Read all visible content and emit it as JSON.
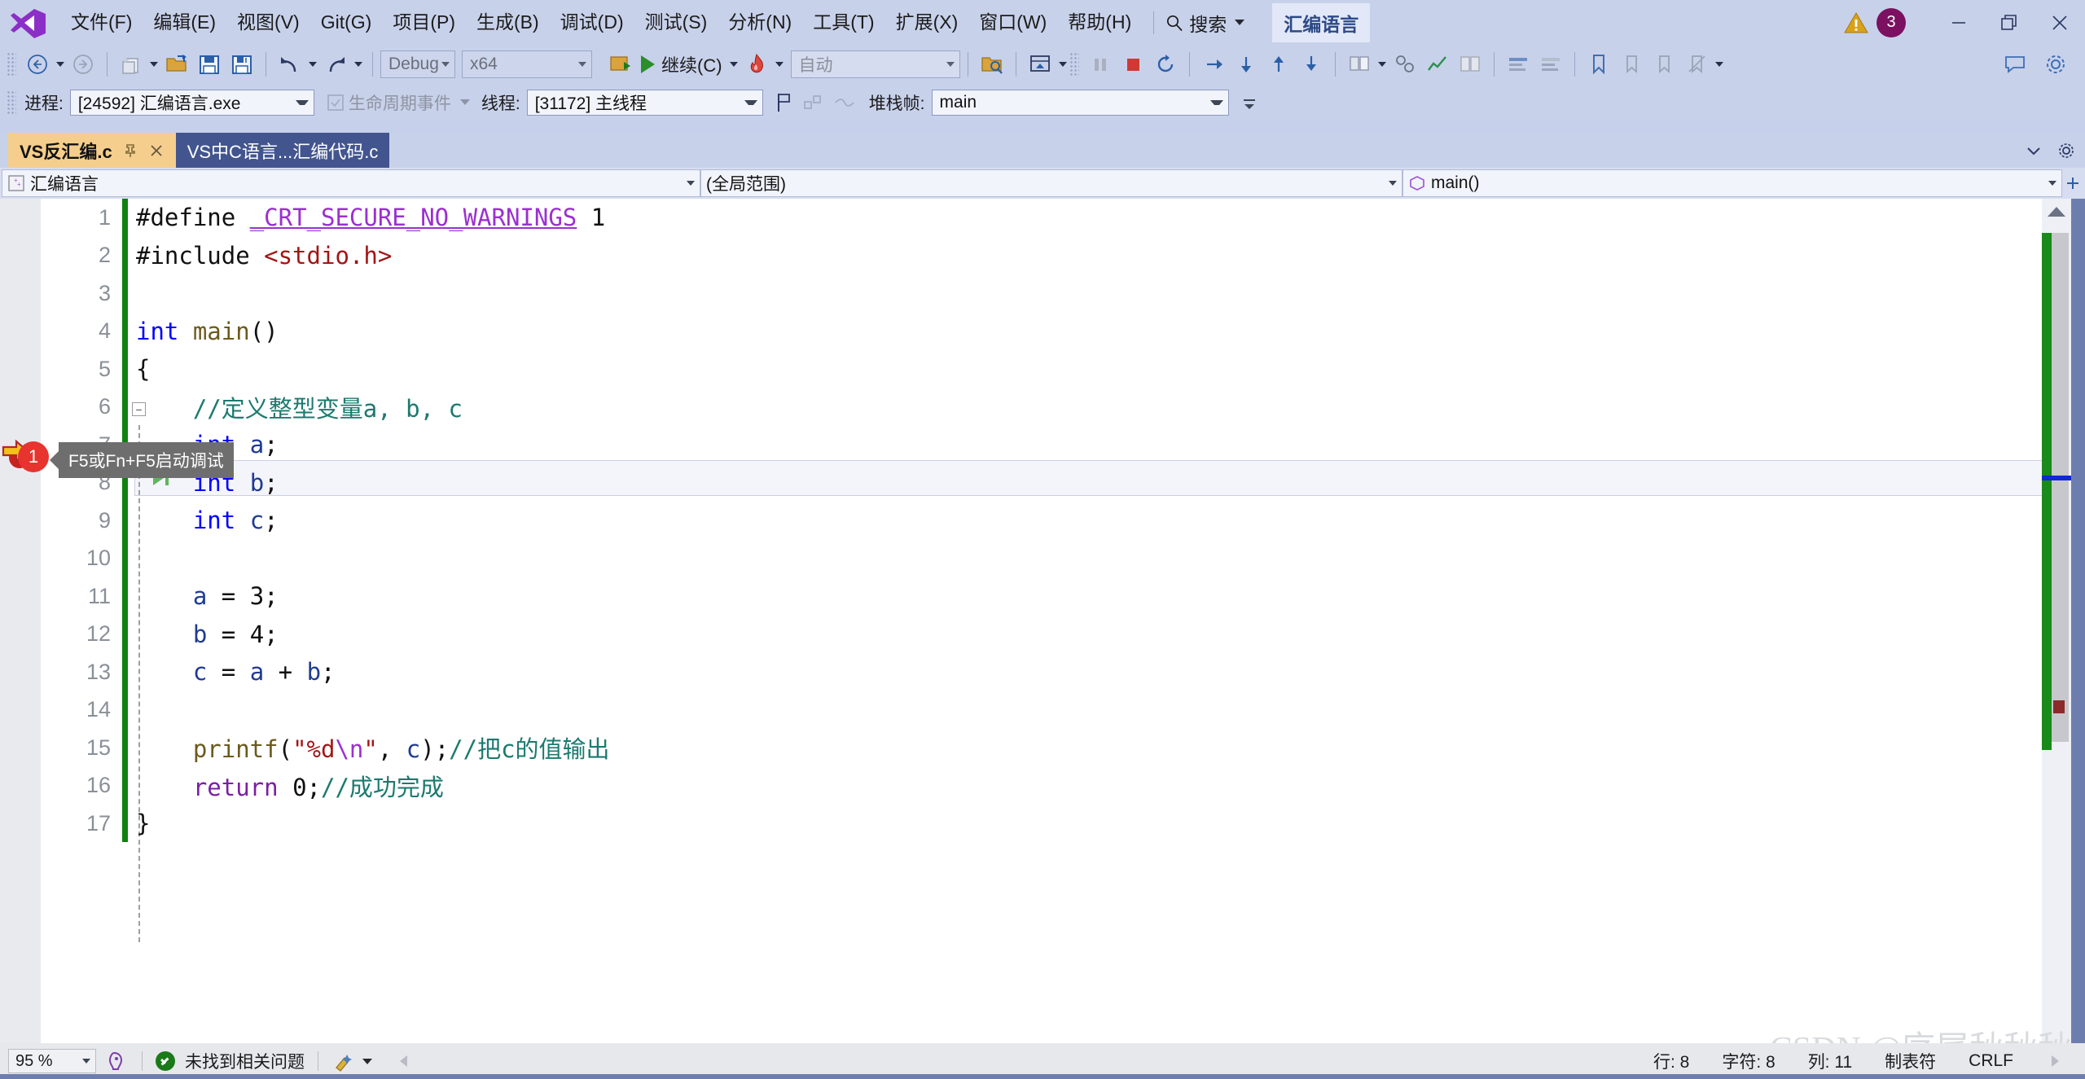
{
  "menu": {
    "items": [
      "文件(F)",
      "编辑(E)",
      "视图(V)",
      "Git(G)",
      "项目(P)",
      "生成(B)",
      "调试(D)",
      "测试(S)",
      "分析(N)",
      "工具(T)",
      "扩展(X)",
      "窗口(W)",
      "帮助(H)"
    ],
    "search_label": "搜索",
    "solution_name": "汇编语言",
    "notification_count": "3"
  },
  "toolbar": {
    "config": "Debug",
    "platform": "x64",
    "continue_label": "继续(C)",
    "auto_placeholder": "自动"
  },
  "debugbar": {
    "process_label": "进程:",
    "process_value": "[24592] 汇编语言.exe",
    "lifecycle_label": "生命周期事件",
    "thread_label": "线程:",
    "thread_value": "[31172] 主线程",
    "stackframe_label": "堆栈帧:",
    "stackframe_value": "main"
  },
  "tabs": [
    {
      "label": "VS反汇编.c",
      "active": true
    },
    {
      "label": "VS中C语言...汇编代码.c",
      "active": false
    }
  ],
  "navbar": {
    "project": "汇编语言",
    "scope": "(全局范围)",
    "member": "main()"
  },
  "editor": {
    "lines": [
      {
        "n": "1",
        "tokens": [
          {
            "t": "#define ",
            "c": "t-pp"
          },
          {
            "t": "_CRT_SECURE_NO_WARNINGS",
            "c": "t-macro"
          },
          {
            "t": " 1",
            "c": "t-plain"
          }
        ]
      },
      {
        "n": "2",
        "tokens": [
          {
            "t": "#include ",
            "c": "t-pp"
          },
          {
            "t": "<stdio.h>",
            "c": "t-inc"
          }
        ]
      },
      {
        "n": "3",
        "tokens": []
      },
      {
        "n": "4",
        "tokens": [
          {
            "t": "int ",
            "c": "t-key"
          },
          {
            "t": "main",
            "c": "t-fn"
          },
          {
            "t": "()",
            "c": "t-plain"
          }
        ]
      },
      {
        "n": "5",
        "tokens": [
          {
            "t": "{",
            "c": "t-plain"
          }
        ]
      },
      {
        "n": "6",
        "tokens": [
          {
            "t": "    //定义整型变量a, b, c",
            "c": "t-cmt"
          }
        ]
      },
      {
        "n": "7",
        "tokens": [
          {
            "t": "    ",
            "c": "t-plain"
          },
          {
            "t": "int ",
            "c": "t-key"
          },
          {
            "t": "a",
            "c": "t-var"
          },
          {
            "t": ";",
            "c": "t-plain"
          }
        ]
      },
      {
        "n": "8",
        "tokens": [
          {
            "t": "    ",
            "c": "t-plain"
          },
          {
            "t": "int ",
            "c": "t-key"
          },
          {
            "t": "b",
            "c": "t-var"
          },
          {
            "t": ";",
            "c": "t-plain"
          }
        ]
      },
      {
        "n": "9",
        "tokens": [
          {
            "t": "    ",
            "c": "t-plain"
          },
          {
            "t": "int ",
            "c": "t-key"
          },
          {
            "t": "c",
            "c": "t-var"
          },
          {
            "t": ";",
            "c": "t-plain"
          }
        ]
      },
      {
        "n": "10",
        "tokens": []
      },
      {
        "n": "11",
        "tokens": [
          {
            "t": "    ",
            "c": "t-plain"
          },
          {
            "t": "a",
            "c": "t-var"
          },
          {
            "t": " = ",
            "c": "t-plain"
          },
          {
            "t": "3",
            "c": "t-num"
          },
          {
            "t": ";",
            "c": "t-plain"
          }
        ]
      },
      {
        "n": "12",
        "tokens": [
          {
            "t": "    ",
            "c": "t-plain"
          },
          {
            "t": "b",
            "c": "t-var"
          },
          {
            "t": " = ",
            "c": "t-plain"
          },
          {
            "t": "4",
            "c": "t-num"
          },
          {
            "t": ";",
            "c": "t-plain"
          }
        ]
      },
      {
        "n": "13",
        "tokens": [
          {
            "t": "    ",
            "c": "t-plain"
          },
          {
            "t": "c",
            "c": "t-var"
          },
          {
            "t": " = ",
            "c": "t-plain"
          },
          {
            "t": "a",
            "c": "t-var"
          },
          {
            "t": " + ",
            "c": "t-plain"
          },
          {
            "t": "b",
            "c": "t-var"
          },
          {
            "t": ";",
            "c": "t-plain"
          }
        ]
      },
      {
        "n": "14",
        "tokens": []
      },
      {
        "n": "15",
        "tokens": [
          {
            "t": "    ",
            "c": "t-plain"
          },
          {
            "t": "printf",
            "c": "t-fn"
          },
          {
            "t": "(",
            "c": "t-plain"
          },
          {
            "t": "\"%d",
            "c": "t-str"
          },
          {
            "t": "\\n",
            "c": "t-esc"
          },
          {
            "t": "\"",
            "c": "t-str"
          },
          {
            "t": ", ",
            "c": "t-plain"
          },
          {
            "t": "c",
            "c": "t-var"
          },
          {
            "t": ");",
            "c": "t-plain"
          },
          {
            "t": "//把c的值输出",
            "c": "t-cmt"
          }
        ]
      },
      {
        "n": "16",
        "tokens": [
          {
            "t": "    ",
            "c": "t-plain"
          },
          {
            "t": "return ",
            "c": "t-kw2"
          },
          {
            "t": "0",
            "c": "t-num"
          },
          {
            "t": ";",
            "c": "t-plain"
          },
          {
            "t": "//成功完成",
            "c": "t-cmt"
          }
        ]
      },
      {
        "n": "17",
        "tokens": [
          {
            "t": "}",
            "c": "t-plain"
          }
        ]
      }
    ],
    "current_line": "8",
    "breakpoint_line": "15",
    "tooltip_text": "F5或Fn+F5启动调试",
    "annotation_badge": "1"
  },
  "statusbar": {
    "zoom": "95 %",
    "issues": "未找到相关问题",
    "row_label": "行: 8",
    "char_label": "字符: 8",
    "col_label": "列: 11",
    "tabs_label": "制表符",
    "eol_label": "CRLF"
  },
  "watermark": "CSDN @序属秋秋秋",
  "colors": {
    "chrome": "#c8d1ea",
    "accent_tab_active": "#f5ce8d",
    "accent_tab_inactive": "#43558f",
    "badge": "#7b1160",
    "breakpoint": "#c9211e",
    "changebar": "#108010"
  }
}
